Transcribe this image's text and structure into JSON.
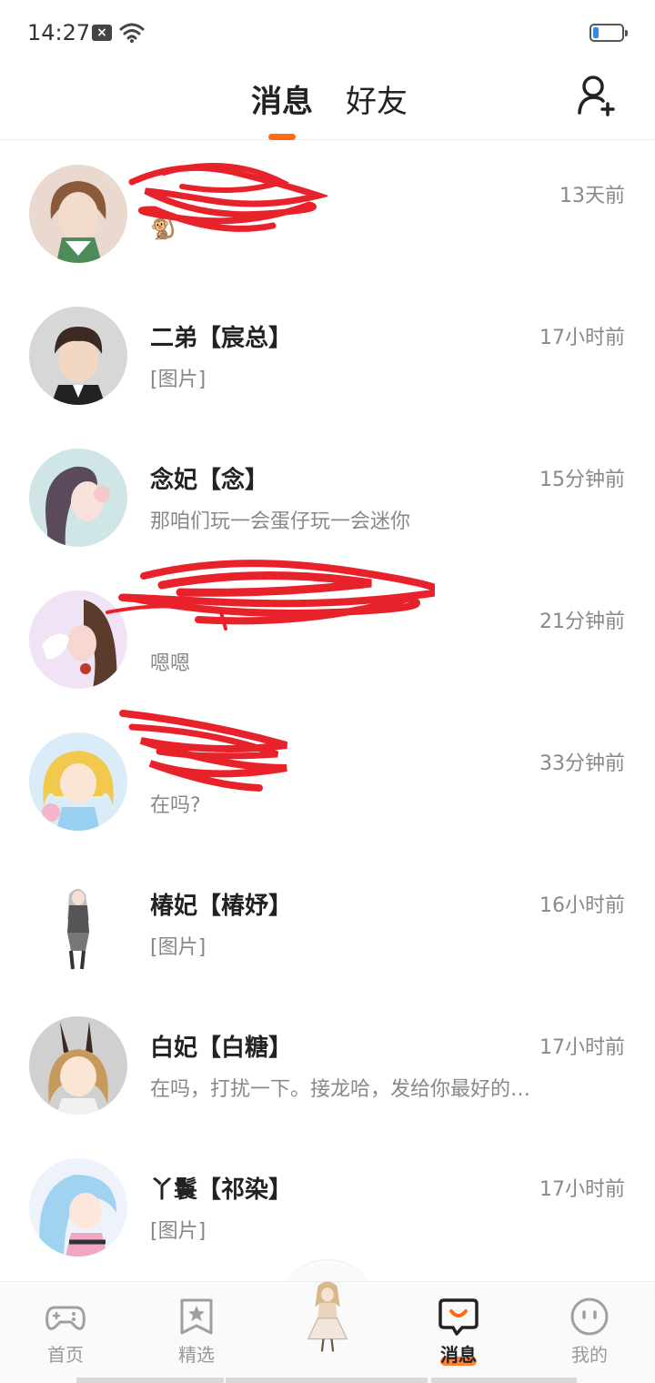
{
  "status_bar": {
    "time": "14:27"
  },
  "header": {
    "tabs": [
      {
        "label": "消息"
      },
      {
        "label": "好友"
      }
    ]
  },
  "messages": [
    {
      "name": "",
      "preview": "",
      "time": "13天前",
      "avatar_colors": [
        "#e9d9cf",
        "#8b5a3c",
        "#4d8c58"
      ]
    },
    {
      "name": "二弟【宸总】",
      "preview": "[图片]",
      "time": "17小时前",
      "avatar_colors": [
        "#d7d7d7",
        "#3d2a22",
        "#f2d7c2"
      ]
    },
    {
      "name": "念妃【念】",
      "preview": "那咱们玩一会蛋仔玩一会迷你",
      "time": "15分钟前",
      "avatar_colors": [
        "#cfe5e6",
        "#5a4a5c",
        "#f4c9c9"
      ]
    },
    {
      "name": "",
      "preview": "嗯嗯",
      "time": "21分钟前",
      "avatar_colors": [
        "#efe3f5",
        "#5b3b2b",
        "#f7d7d0"
      ]
    },
    {
      "name": "",
      "preview": "在吗?",
      "time": "33分钟前",
      "avatar_colors": [
        "#d9ecf8",
        "#f2c94c",
        "#f6b6c8"
      ]
    },
    {
      "name": "椿妃【椿妤】",
      "preview": "[图片]",
      "time": "16小时前",
      "avatar_colors": [
        "#ffffff",
        "#9a9a9a",
        "#333333"
      ]
    },
    {
      "name": "白妃【白糖】",
      "preview": "在吗，打扰一下。接龙哈，发给你最好的人，不管是帮助过你的人…",
      "time": "17小时前",
      "avatar_colors": [
        "#d0d0d0",
        "#c69a5a",
        "#3a2a22"
      ]
    },
    {
      "name": "丫鬟【祁染】",
      "preview": "[图片]",
      "time": "17小时前",
      "avatar_colors": [
        "#eef3fb",
        "#9fd3ef",
        "#f2a6c4"
      ]
    }
  ],
  "nav": {
    "home": "首页",
    "featured": "精选",
    "messages": "消息",
    "mine": "我的"
  },
  "colors": {
    "accent": "#ff6a13",
    "scribble": "#e8222a"
  }
}
